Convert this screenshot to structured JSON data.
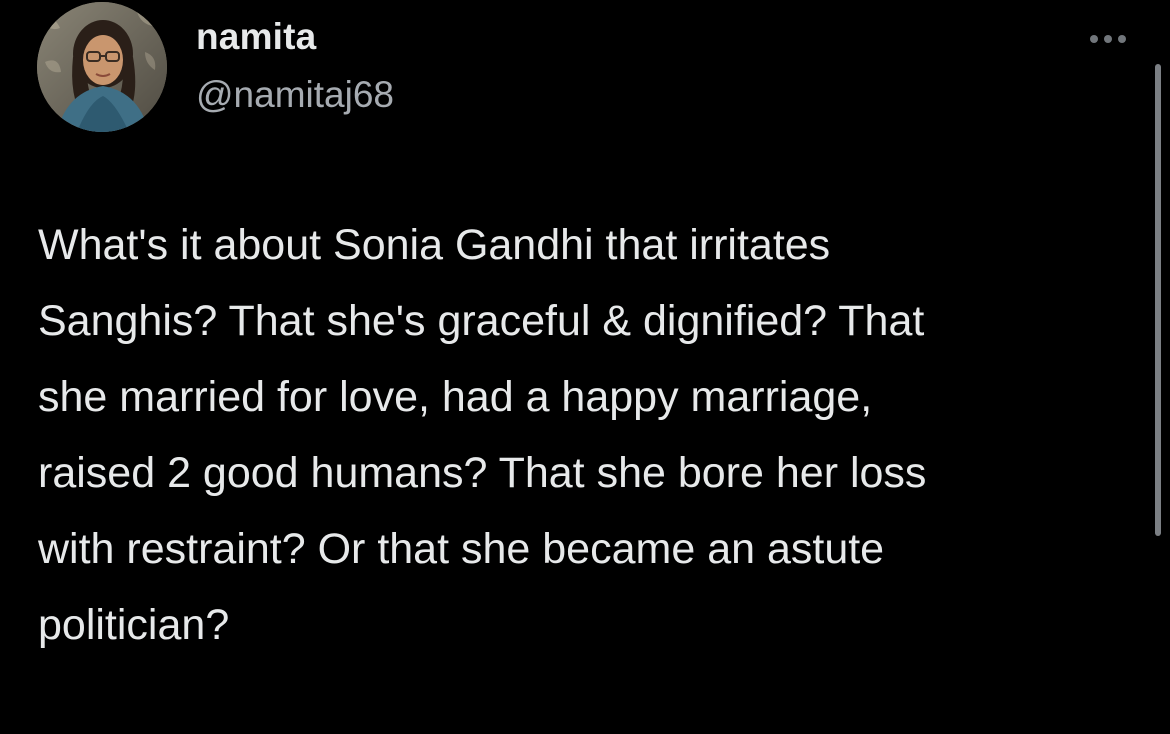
{
  "author": {
    "display_name": "namita",
    "handle": "@namitaj68",
    "avatar_icon": "profile-photo-avatar"
  },
  "menu": {
    "icon": "more-horizontal-icon"
  },
  "tweet": {
    "text": "What's it about Sonia Gandhi that irritates\nSanghis? That  she's graceful & dignified? That\nshe married for love, had a happy marriage,\nraised 2 good humans? That she bore her loss\nwith restraint? Or that she became an astute\npolitician?"
  },
  "colors": {
    "background": "#000000",
    "primary_text": "#e7e9ea",
    "secondary_text": "#a6abb1",
    "icon": "#71767b",
    "scrollbar": "#7b7f84"
  }
}
